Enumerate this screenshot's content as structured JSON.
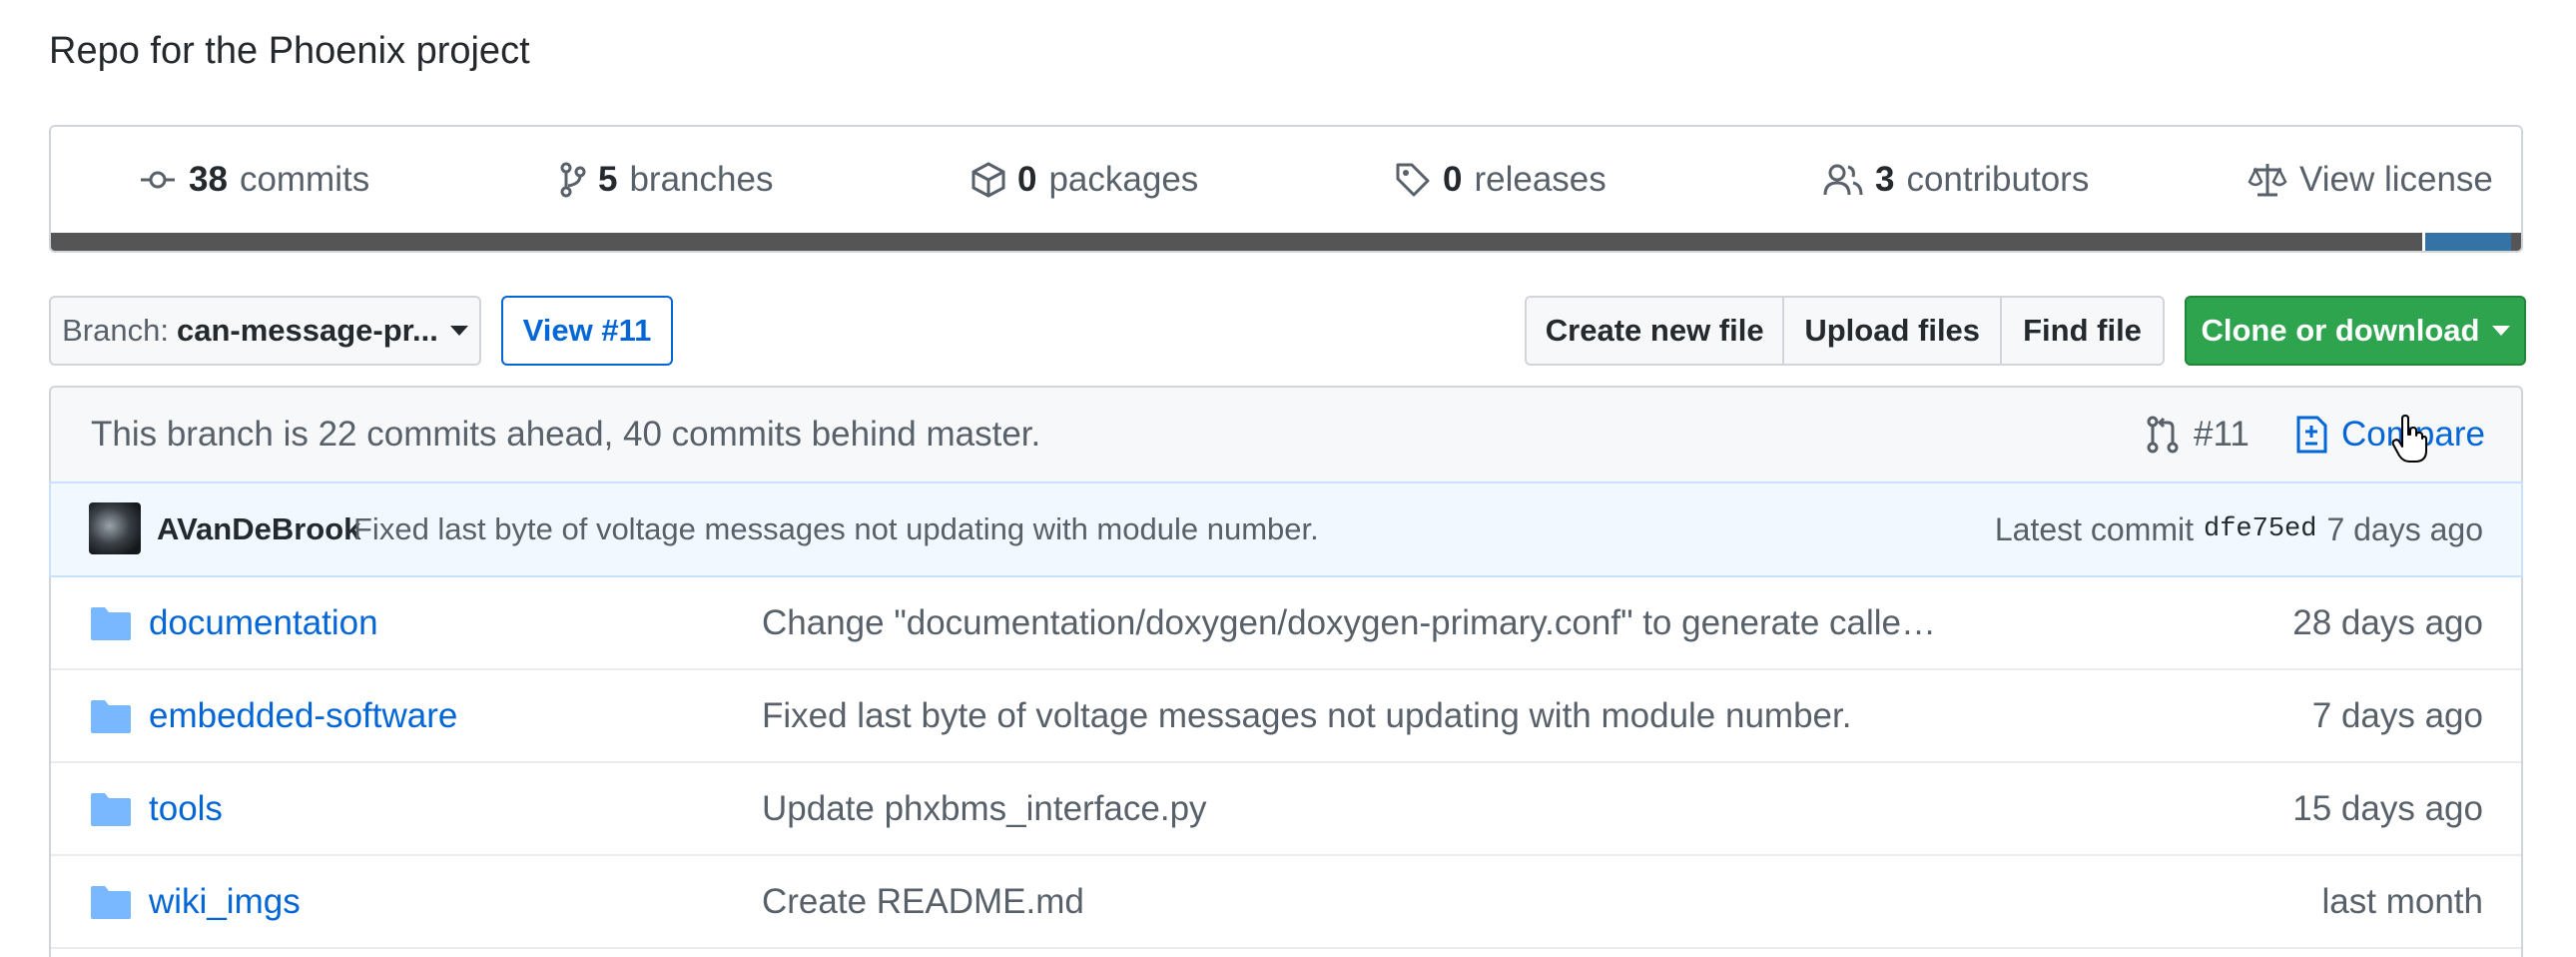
{
  "repo": {
    "description": "Repo for the Phoenix project"
  },
  "summary": {
    "commits": {
      "count": "38",
      "label": "commits",
      "icon": "commit-icon"
    },
    "branches": {
      "count": "5",
      "label": "branches",
      "icon": "branch-icon"
    },
    "packages": {
      "count": "0",
      "label": "packages",
      "icon": "package-icon"
    },
    "releases": {
      "count": "0",
      "label": "releases",
      "icon": "tag-icon"
    },
    "contributors": {
      "count": "3",
      "label": "contributors",
      "icon": "people-icon"
    },
    "license": {
      "label": "View license",
      "icon": "law-icon"
    },
    "language_colors": [
      "#555555",
      "#3572A5"
    ]
  },
  "toolbar": {
    "branch_prefix": "Branch:",
    "branch_name": "can-message-pr...",
    "view_pr": "View #11",
    "create_file": "Create new file",
    "upload_files": "Upload files",
    "find_file": "Find file",
    "clone": "Clone or download"
  },
  "branch_info": {
    "text": "This branch is 22 commits ahead, 40 commits behind master.",
    "pr_ref": "#11",
    "compare": "Compare"
  },
  "latest_commit": {
    "author": "AVanDeBrook",
    "message": "Fixed last byte of voltage messages not updating with module number.",
    "prefix": "Latest commit",
    "sha": "dfe75ed",
    "age": "7 days ago"
  },
  "files": [
    {
      "name": "documentation",
      "message": "Change \"documentation/doxygen/doxygen-primary.conf\" to generate calle…",
      "age": "28 days ago"
    },
    {
      "name": "embedded-software",
      "message": "Fixed last byte of voltage messages not updating with module number.",
      "age": "7 days ago"
    },
    {
      "name": "tools",
      "message": "Update phxbms_interface.py",
      "age": "15 days ago"
    },
    {
      "name": "wiki_imgs",
      "message": "Create README.md",
      "age": "last month"
    }
  ],
  "colors": {
    "link": "#0366d6",
    "clone_green": "#2ea44f",
    "muted": "#586069",
    "folder": "#79b8ff"
  }
}
